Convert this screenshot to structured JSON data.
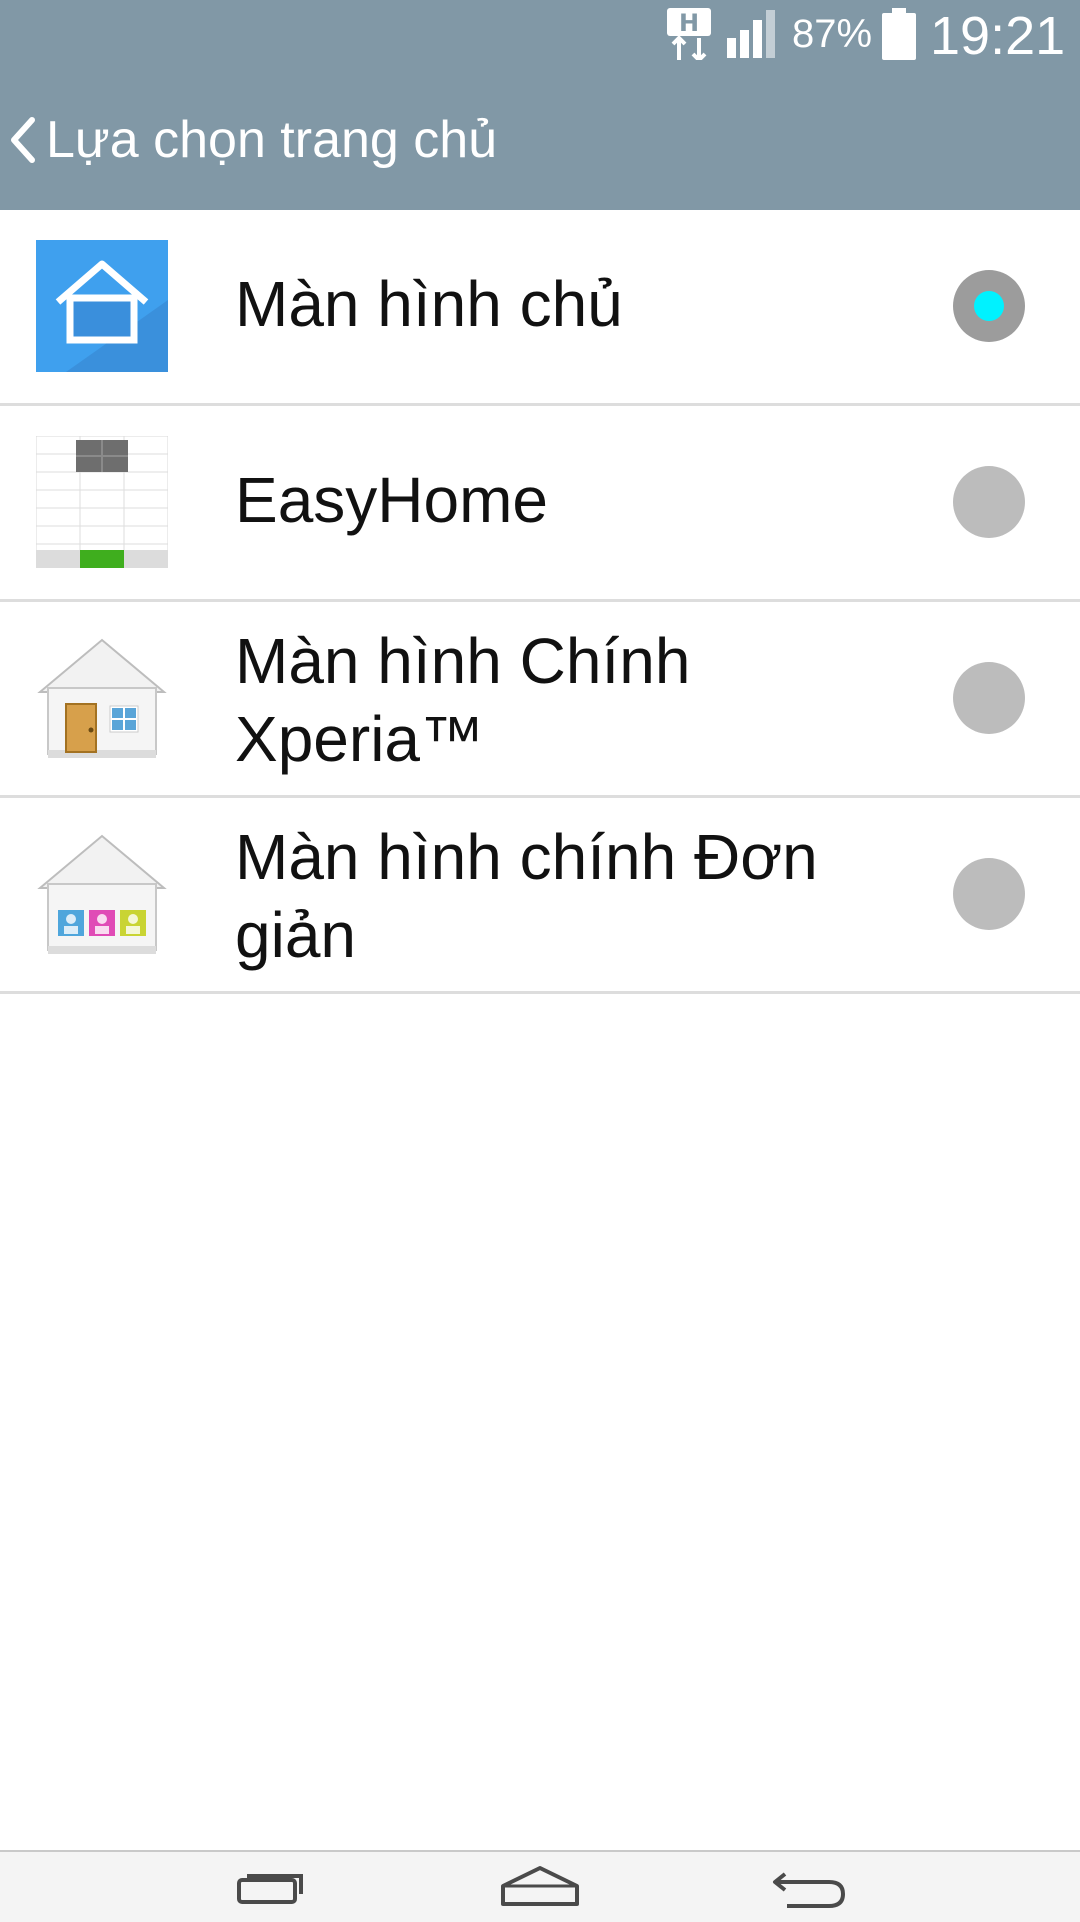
{
  "status_bar": {
    "network_type": "H",
    "battery_percent": "87%",
    "time": "19:21"
  },
  "action_bar": {
    "title": "Lựa chọn trang chủ"
  },
  "options": [
    {
      "label": "Màn hình chủ",
      "selected": true,
      "icon": "lg-home-icon"
    },
    {
      "label": "EasyHome",
      "selected": false,
      "icon": "easyhome-icon"
    },
    {
      "label": "Màn hình Chính Xperia™",
      "selected": false,
      "icon": "xperia-home-icon"
    },
    {
      "label": "Màn hình chính Đơn giản",
      "selected": false,
      "icon": "simple-home-icon"
    }
  ],
  "colors": {
    "header": "#8198a6",
    "radio_selected_dot": "#00f2ff",
    "radio_unselected": "#bcbcbc",
    "divider": "#dddddd"
  },
  "nav_bar": {
    "icons": [
      "recent-apps-icon",
      "home-icon",
      "back-icon"
    ]
  }
}
